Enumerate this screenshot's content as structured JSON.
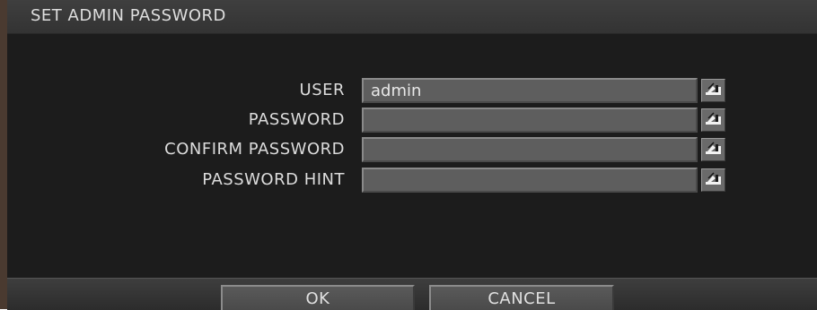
{
  "dialog": {
    "title": "SET ADMIN PASSWORD"
  },
  "fields": [
    {
      "label": "USER",
      "value": "admin",
      "icon": "keyboard-icon"
    },
    {
      "label": "PASSWORD",
      "value": "",
      "icon": "keyboard-icon"
    },
    {
      "label": "CONFIRM PASSWORD",
      "value": "",
      "icon": "keyboard-icon"
    },
    {
      "label": "PASSWORD HINT",
      "value": "",
      "icon": "keyboard-icon"
    }
  ],
  "buttons": {
    "ok_label": "OK",
    "cancel_label": "CANCEL"
  },
  "colors": {
    "background": "#1c1c1c",
    "title_bar": "#3a3a3a",
    "input_fill": "#5e5e5e",
    "text": "#dcdcdc"
  }
}
